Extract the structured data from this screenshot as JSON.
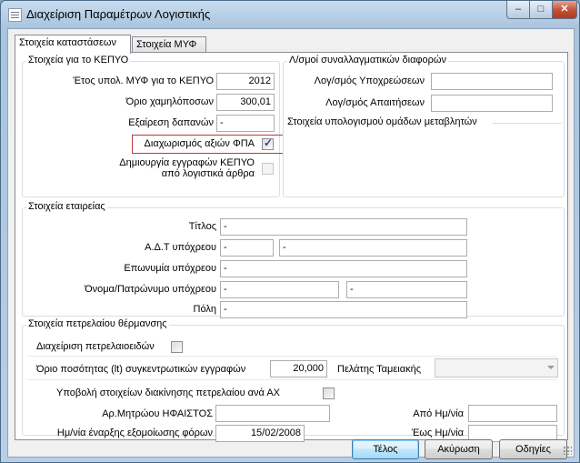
{
  "window": {
    "title": "Διαχείριση Παραμέτρων Λογιστικής"
  },
  "tabs": [
    {
      "label": "Στοιχεία καταστάσεων"
    },
    {
      "label": "Στοιχεία ΜΥΦ"
    }
  ],
  "kepyo": {
    "title": "Στοιχεία για το ΚΕΠΥΟ",
    "year_label": "Έτος υπολ. ΜΥΦ για το ΚΕΠΥΟ",
    "year_value": "2012",
    "threshold_label": "Όριο χαμηλόποσων",
    "threshold_value": "300,01",
    "exclusion_label": "Εξαίρεση δαπανών",
    "exclusion_value": "-",
    "vat_split_label": "Διαχωρισμός αξιών ΦΠΑ",
    "vat_split_checked": true,
    "create_entries_label_1": "Δημιουργία εγγραφών ΚΕΠΥΟ",
    "create_entries_label_2": "από λογιστικά άρθρα",
    "create_entries_checked": false
  },
  "fx": {
    "title": "Λ/σμοί συναλλαγματικών διαφορών",
    "payables_label": "Λογ/σμός Υποχρεώσεων",
    "payables_value": "",
    "receivables_label": "Λογ/σμός Απαιτήσεων",
    "receivables_value": ""
  },
  "variables": {
    "title": "Στοιχεία υπολογισμού ομάδων μεταβλητών"
  },
  "company": {
    "title": "Στοιχεία εταιρείας",
    "name_label": "Τίτλος",
    "name_value": "-",
    "tin_label": "Α.Δ.Τ υπόχρεου",
    "tin_value_1": "-",
    "tin_value_2": "-",
    "brand_label": "Επωνυμία υπόχρεου",
    "brand_value": "-",
    "fullname_label": "Όνομα/Πατρώνυμο υπόχρεου",
    "fullname_value_1": "-",
    "fullname_value_2": "-",
    "city_label": "Πόλη",
    "city_value": "-"
  },
  "fuel": {
    "title": "Στοιχεία πετρελαίου θέρμανσης",
    "manage_label": "Διαχείριση πετρελαιοειδών",
    "manage_checked": false,
    "limit_label": "Όριο ποσότητας (lt) συγκεντρωτικών εγγραφών",
    "limit_value": "20,000",
    "customer_label": "Πελάτης Ταμειακής",
    "customer_value": "",
    "submit_label": "Υποβολή στοιχείων διακίνησης πετρελαίου ανά ΑΧ",
    "submit_checked": false,
    "registry_label": "Αρ.Μητρώου ΗΦΑΙΣΤΟΣ",
    "registry_value": "",
    "start_date_label": "Ημ/νία έναρξης εξομοίωσης φόρων",
    "start_date_value": "15/02/2008",
    "from_date_label": "Από Ημ/νία",
    "from_date_value": "",
    "to_date_label": "Έως Ημ/νία",
    "to_date_value": ""
  },
  "buttons": {
    "ok": "Τέλος",
    "cancel": "Ακύρωση",
    "help": "Οδηγίες"
  },
  "icons": {
    "minimize": "minimize-icon",
    "maximize": "maximize-icon",
    "close": "close-icon",
    "check": "checkmark-icon"
  }
}
